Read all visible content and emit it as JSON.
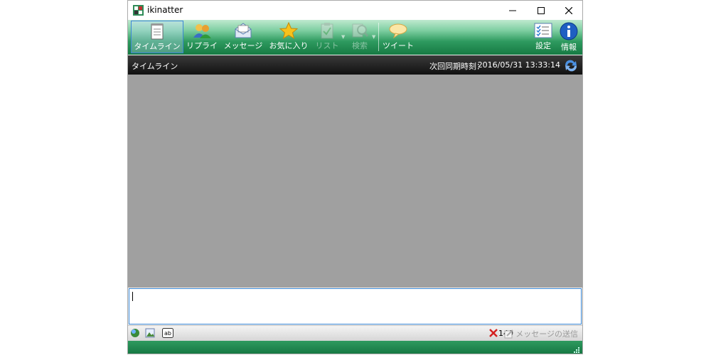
{
  "window": {
    "title": "ikinatter"
  },
  "toolbar": {
    "items": [
      {
        "label": "タイムライン",
        "icon": "notepad-icon",
        "state": "active"
      },
      {
        "label": "リプライ",
        "icon": "users-icon",
        "state": "enabled"
      },
      {
        "label": "メッセージ",
        "icon": "envelope-icon",
        "state": "enabled"
      },
      {
        "label": "お気に入り",
        "icon": "star-icon",
        "state": "enabled"
      },
      {
        "label": "リスト",
        "icon": "clipboard-icon",
        "state": "disabled"
      },
      {
        "label": "検索",
        "icon": "search-icon",
        "state": "disabled"
      },
      {
        "label": "ツイート",
        "icon": "speech-bubble-icon",
        "state": "enabled"
      },
      {
        "label": "設定",
        "icon": "settings-checklist-icon",
        "state": "enabled"
      },
      {
        "label": "情報",
        "icon": "info-icon",
        "state": "enabled"
      }
    ]
  },
  "header": {
    "title": "タイムライン",
    "sync_label": "次回同期時刻：",
    "sync_time": "2016/05/31 13:33:14"
  },
  "compose": {
    "value": ""
  },
  "footer": {
    "char_count": "140",
    "send_label": "メッセージの送信"
  },
  "colors": {
    "toolbar_green": "#2e9a5f",
    "content_gray": "#a0a0a0",
    "header_dark": "#1a1a1a",
    "focus_blue": "#3c8ad8"
  }
}
